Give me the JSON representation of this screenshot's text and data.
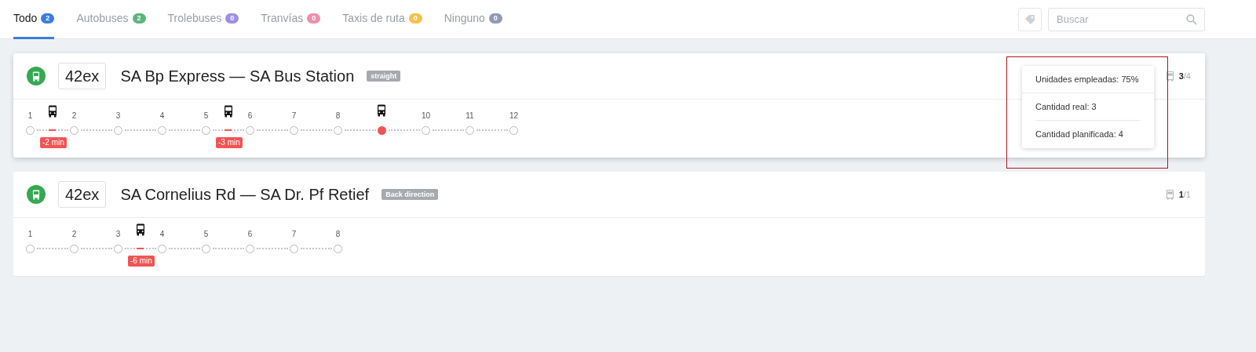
{
  "tabs": [
    {
      "label": "Todo",
      "count": "2",
      "color": "#3b7ddd",
      "selected": true
    },
    {
      "label": "Autobuses",
      "count": "2",
      "color": "#5cb57a",
      "selected": false
    },
    {
      "label": "Trolebuses",
      "count": "0",
      "color": "#a08ee8",
      "selected": false
    },
    {
      "label": "Tranvías",
      "count": "0",
      "color": "#ef8fae",
      "selected": false
    },
    {
      "label": "Taxis de ruta",
      "count": "0",
      "color": "#f6c244",
      "selected": false
    },
    {
      "label": "Ninguno",
      "count": "0",
      "color": "#8f9bb5",
      "selected": false
    }
  ],
  "search": {
    "placeholder": "Buscar"
  },
  "routes": [
    {
      "number": "42ex",
      "name": "SA Bp Express — SA Bus Station",
      "direction": "straight",
      "actual": "3",
      "planned": "/4",
      "popover": [
        "Unidades empleadas: 75%",
        "Cantidad real: 3",
        "Cantidad planificada: 4"
      ],
      "stops": [
        {
          "label": "1",
          "current": false,
          "bus_after": true,
          "delay": "-2 min"
        },
        {
          "label": "2",
          "current": false,
          "bus_after": false
        },
        {
          "label": "3",
          "current": false,
          "bus_after": false
        },
        {
          "label": "4",
          "current": false,
          "bus_after": false
        },
        {
          "label": "5",
          "current": false,
          "bus_after": true,
          "delay": "-3 min"
        },
        {
          "label": "6",
          "current": false,
          "bus_after": false
        },
        {
          "label": "7",
          "current": false,
          "bus_after": false
        },
        {
          "label": "8",
          "current": false,
          "bus_after": false
        },
        {
          "current": true,
          "bus_after": false
        },
        {
          "label": "10",
          "current": false,
          "bus_after": false
        },
        {
          "label": "11",
          "current": false,
          "bus_after": false
        },
        {
          "label": "12",
          "current": false
        }
      ]
    },
    {
      "number": "42ex",
      "name": "SA Cornelius Rd — SA Dr. Pf Retief",
      "direction": "Back direction",
      "actual": "1",
      "planned": "/1",
      "stops": [
        {
          "label": "1",
          "current": false,
          "bus_after": false
        },
        {
          "label": "2",
          "current": false,
          "bus_after": false
        },
        {
          "label": "3",
          "current": false,
          "bus_after": true,
          "delay": "-6 min"
        },
        {
          "label": "4",
          "current": false,
          "bus_after": false
        },
        {
          "label": "5",
          "current": false,
          "bus_after": false
        },
        {
          "label": "6",
          "current": false,
          "bus_after": false
        },
        {
          "label": "7",
          "current": false,
          "bus_after": false
        },
        {
          "label": "8",
          "current": false
        }
      ]
    }
  ]
}
